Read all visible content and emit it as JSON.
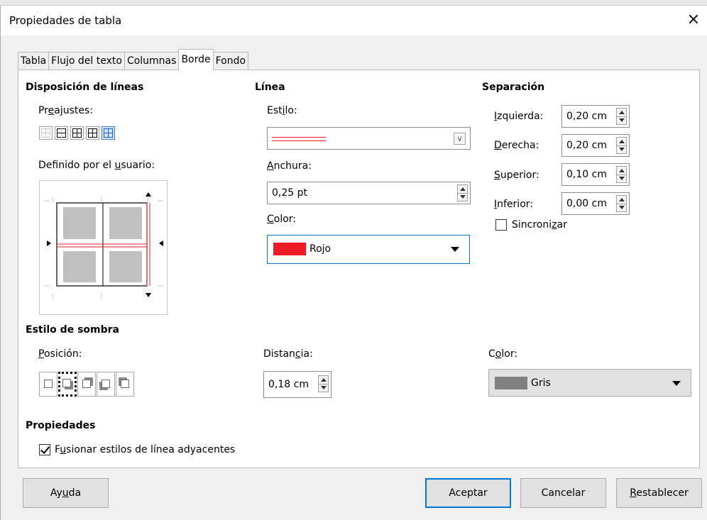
{
  "window": {
    "title": "Propiedades de tabla",
    "close_glyph": "✕"
  },
  "tabs": [
    {
      "label": "Tabla"
    },
    {
      "label": "Flujo del texto"
    },
    {
      "label": "Columnas"
    },
    {
      "label": "Borde"
    },
    {
      "label": "Fondo"
    }
  ],
  "active_tab": "Borde",
  "line_arrangement": {
    "heading": "Disposición de líneas",
    "presets_label": {
      "pre": "Pr",
      "u": "e",
      "post": "ajustes:"
    },
    "user_defined_label": {
      "pre": "Definido por el ",
      "u": "u",
      "post": "suario:"
    }
  },
  "line": {
    "heading": "Línea",
    "style_label": {
      "pre": "Est",
      "u": "i",
      "post": "lo:"
    },
    "width_label": {
      "pre": "",
      "u": "A",
      "post": "nchura:"
    },
    "width_value": "0,25 pt",
    "color_label": {
      "pre": "",
      "u": "C",
      "post": "olor:"
    },
    "color_value": "Rojo",
    "color_hex": "#ed1c24"
  },
  "spacing": {
    "heading": "Separación",
    "left": {
      "pre": "",
      "u": "I",
      "post": "zquierda:",
      "value": "0,20 cm"
    },
    "right": {
      "pre": "",
      "u": "D",
      "post": "erecha:",
      "value": "0,20 cm"
    },
    "top": {
      "pre": "",
      "u": "S",
      "post": "uperior:",
      "value": "0,10 cm"
    },
    "bottom": {
      "pre": "",
      "u": "I",
      "post": "nferior:",
      "value": "0,00 cm"
    },
    "sync_label": {
      "pre": "Sincroni",
      "u": "z",
      "post": "ar"
    },
    "sync_checked": false
  },
  "shadow": {
    "heading": "Estilo de sombra",
    "position_label": {
      "pre": "",
      "u": "P",
      "post": "osición:"
    },
    "distance_label": {
      "pre": "Distan",
      "u": "c",
      "post": "ia:"
    },
    "distance_value": "0,18 cm",
    "color_label": {
      "pre": "C",
      "u": "o",
      "post": "lor:"
    },
    "color_value": "Gris",
    "color_hex": "#808080"
  },
  "properties": {
    "heading": "Propiedades",
    "merge_label": {
      "pre": "F",
      "u": "u",
      "post": "sionar estilos de línea adyacentes"
    },
    "merge_checked": true
  },
  "buttons": {
    "help": {
      "pre": "Ay",
      "u": "u",
      "post": "da"
    },
    "ok": "Aceptar",
    "cancel": "Cancelar",
    "reset": {
      "pre": "",
      "u": "R",
      "post": "establecer"
    }
  }
}
